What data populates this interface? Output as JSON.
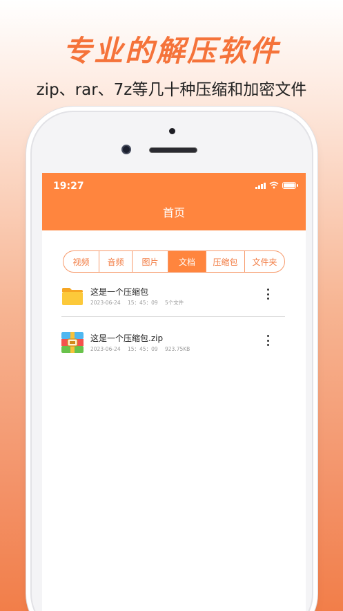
{
  "promo": {
    "headline": "专业的解压软件",
    "subline": "zip、rar、7z等几十种压缩和加密文件"
  },
  "status_bar": {
    "time": "19:27"
  },
  "header": {
    "title": "首页"
  },
  "tabs": [
    {
      "label": "视频",
      "active": false
    },
    {
      "label": "音频",
      "active": false
    },
    {
      "label": "图片",
      "active": false
    },
    {
      "label": "文档",
      "active": true
    },
    {
      "label": "压缩包",
      "active": false
    },
    {
      "label": "文件夹",
      "active": false
    }
  ],
  "files": [
    {
      "name": "这是一个压缩包",
      "date": "2023-06-24",
      "time": "15：45：09",
      "size": "5个文件",
      "icon": "folder-icon"
    },
    {
      "name": "这是一个压缩包.zip",
      "date": "2023-06-24",
      "time": "15：45：09",
      "size": "923.75KB",
      "icon": "zip-archive-icon"
    }
  ],
  "colors": {
    "accent": "#ff853e",
    "headline": "#f5733a"
  }
}
